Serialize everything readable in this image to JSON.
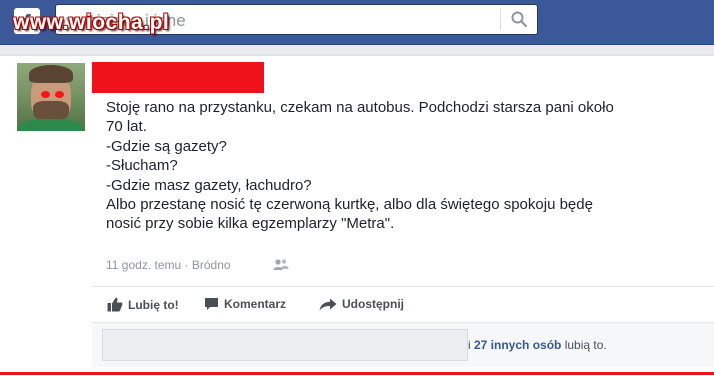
{
  "header": {
    "logo": "f",
    "search_placeholder": "Wyszukaj osoby, miejsca i inne",
    "search_placeholder_visible": "y, miejsca i inne",
    "search_icon": "search-icon"
  },
  "watermark": "www.wiocha.pl",
  "post": {
    "author_name_redacted": true,
    "lines": [
      "Stoję rano na przystanku, czekam na autobus. Podchodzi starsza pani około",
      "70 lat.",
      "-Gdzie są gazety?",
      "-Słucham?",
      "-Gdzie masz gazety, łachudro?",
      "Albo przestanę nosić tę czerwoną kurtkę, albo dla świętego spokoju będę",
      "nosić przy sobie kilka egzemplarzy \"Metra\"."
    ],
    "timestamp": "11 godz. temu",
    "separator": " · ",
    "location": "Bródno",
    "audience_icon": "friends-icon"
  },
  "actions": {
    "like": "Lubię to!",
    "comment": "Komentarz",
    "share": "Udostępnij"
  },
  "likes": {
    "prefix": "i ",
    "others": "27 innych osób",
    "suffix": " lubią to."
  },
  "colors": {
    "brand": "#3b5998",
    "redaction": "#f0121b",
    "link": "#365899"
  }
}
